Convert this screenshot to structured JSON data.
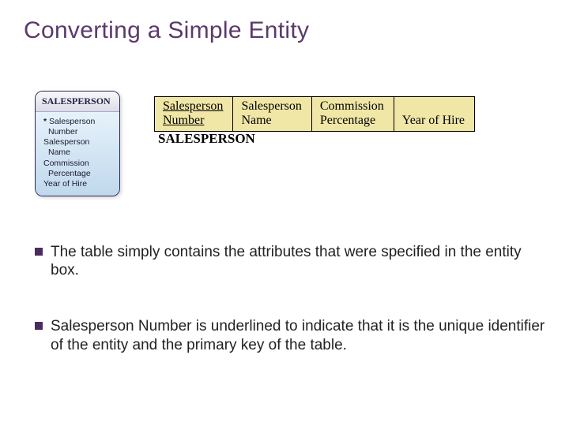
{
  "title": "Converting a Simple Entity",
  "entity": {
    "name": "SALESPERSON",
    "attrs": [
      {
        "label": "Salesperson Number",
        "pk": true
      },
      {
        "label": "Salesperson Name",
        "pk": false
      },
      {
        "label": "Commission Percentage",
        "pk": false
      },
      {
        "label": "Year of Hire",
        "pk": false
      }
    ]
  },
  "relation": {
    "name": "SALESPERSON",
    "columns": [
      {
        "line1": "Salesperson",
        "line2": "Number",
        "pk": true
      },
      {
        "line1": "Salesperson",
        "line2": "Name",
        "pk": false
      },
      {
        "line1": "Commission",
        "line2": "Percentage",
        "pk": false
      },
      {
        "line1": "",
        "line2": "Year of Hire",
        "pk": false
      }
    ]
  },
  "bullets": [
    "The table simply contains the attributes that were specified in the entity box.",
    "Salesperson Number is underlined to indicate that it is the unique identifier of the entity and the primary key of the table."
  ]
}
